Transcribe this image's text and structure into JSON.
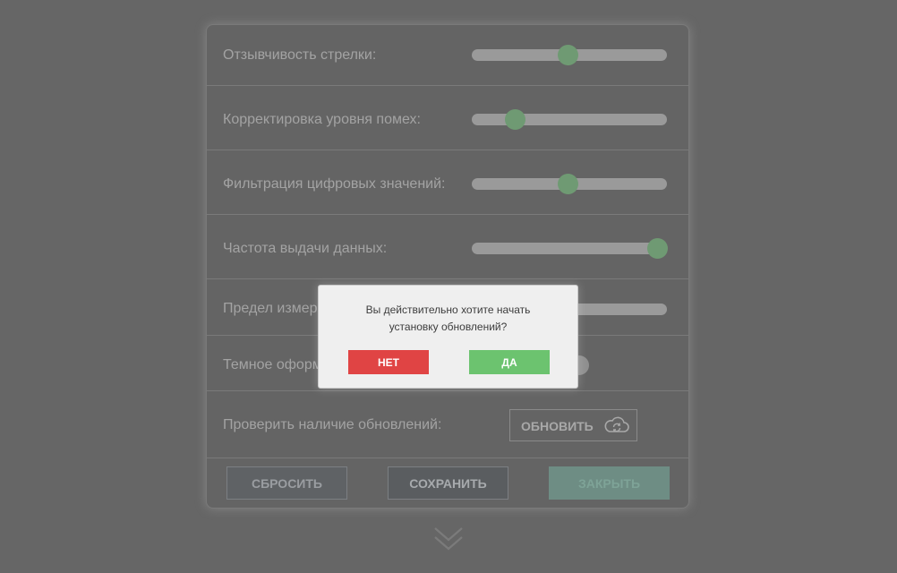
{
  "settings": {
    "rows": [
      {
        "label": "Отзывчивость стрелки:",
        "value": 0.49
      },
      {
        "label": "Корректировка уровня помех:",
        "value": 0.22
      },
      {
        "label": "Фильтрация цифровых значений:",
        "value": 0.49
      },
      {
        "label": "Частота выдачи данных:",
        "value": 0.95
      },
      {
        "label": "Предел измер"
      },
      {
        "label": "Темное оформ"
      }
    ],
    "update_row": {
      "label": "Проверить наличие обновлений:",
      "button_label": "ОБНОВИТЬ",
      "icon": "cloud-refresh-icon"
    },
    "footer": {
      "reset_label": "СБРОСИТЬ",
      "save_label": "СОХРАНИТЬ",
      "close_label": "ЗАКРЫТЬ"
    },
    "expand_icon": "double-chevron-down-icon"
  },
  "dialog": {
    "message_line1": "Вы действительно хотите начать",
    "message_line2": "установку обновлений?",
    "no_label": "НЕТ",
    "yes_label": "ДА"
  },
  "colors": {
    "background": "#666666",
    "accent_green": "#6cc36f",
    "danger_red": "#e04444",
    "slider_thumb": "#6f9a73"
  }
}
